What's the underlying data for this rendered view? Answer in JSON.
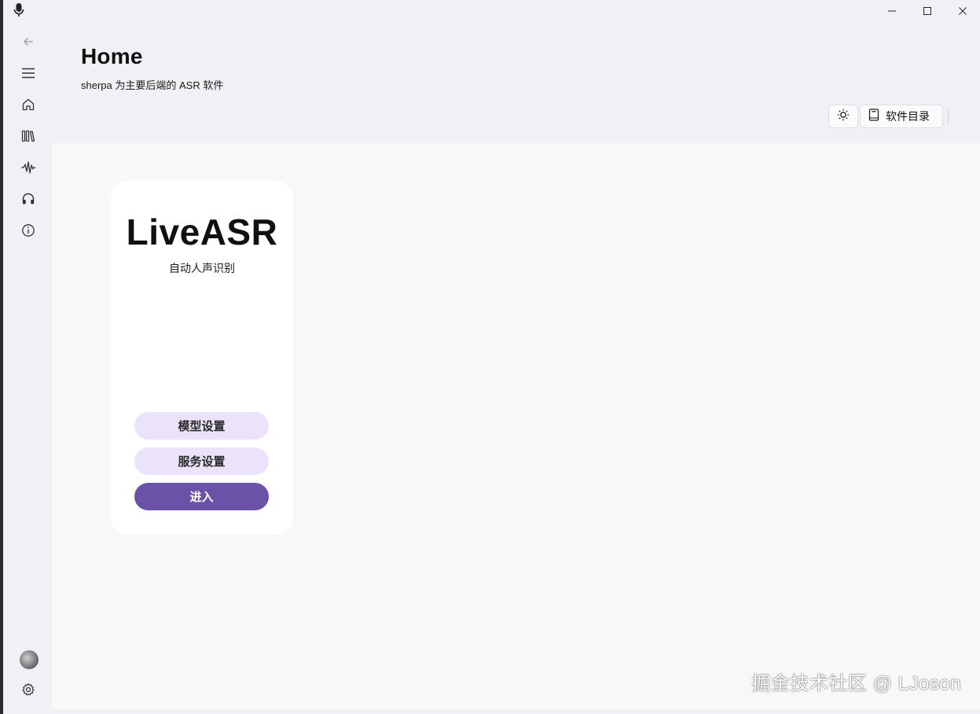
{
  "header": {
    "title": "Home",
    "subtitle": "sherpa 为主要后端的 ASR 软件"
  },
  "toolbar": {
    "theme_icon": "sun-icon",
    "directory_label": "软件目录",
    "directory_icon": "notebook-icon"
  },
  "nav": {
    "items": [
      {
        "name": "back",
        "icon": "back-arrow-icon"
      },
      {
        "name": "menu",
        "icon": "hamburger-icon"
      },
      {
        "name": "home",
        "icon": "home-icon"
      },
      {
        "name": "library",
        "icon": "library-icon"
      },
      {
        "name": "waveform",
        "icon": "waveform-icon"
      },
      {
        "name": "headphones",
        "icon": "headphones-icon"
      },
      {
        "name": "info",
        "icon": "info-icon"
      }
    ],
    "footer": [
      {
        "name": "avatar",
        "icon": "avatar"
      },
      {
        "name": "settings",
        "icon": "gear-icon"
      }
    ]
  },
  "card": {
    "title": "LiveASR",
    "subtitle": "自动人声识别",
    "buttons": {
      "model_settings": "模型设置",
      "service_settings": "服务设置",
      "enter": "进入"
    }
  },
  "colors": {
    "accent": "#6a52a6",
    "accent_light": "#ebe3fb",
    "background": "#f1f1f5",
    "content": "#f8f8f9"
  },
  "watermark": "掘金技术社区 @ LJoson"
}
